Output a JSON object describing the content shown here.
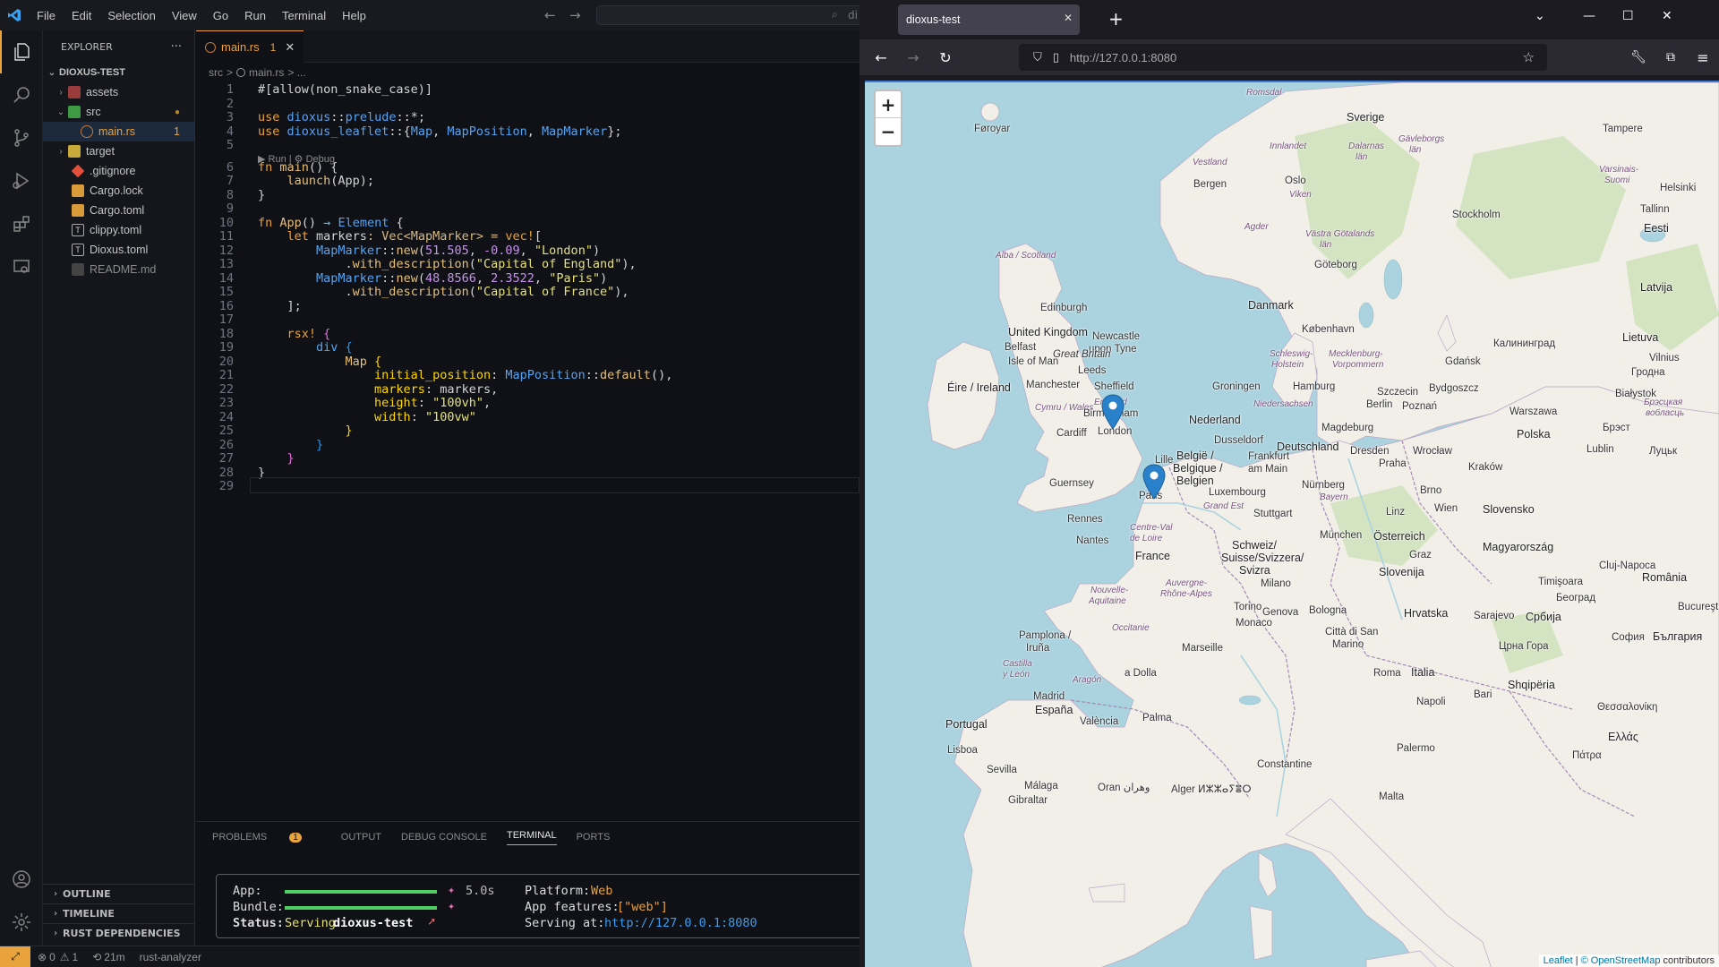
{
  "vscode": {
    "menu": [
      "File",
      "Edit",
      "Selection",
      "View",
      "Go",
      "Run",
      "Terminal",
      "Help"
    ],
    "search_hint": "di",
    "explorer": {
      "title": "EXPLORER",
      "more": "···",
      "project": "DIOXUS-TEST",
      "items": [
        {
          "label": "assets",
          "color": "#c4c4c4"
        },
        {
          "label": "src",
          "color": "#c4c4c4",
          "badge": "●"
        },
        {
          "label": "main.rs",
          "color": "#e8a33c",
          "badge": "1"
        },
        {
          "label": "target",
          "color": "#c4c4c4"
        },
        {
          "label": ".gitignore",
          "color": "#c4c4c4"
        },
        {
          "label": "Cargo.lock",
          "color": "#c4c4c4"
        },
        {
          "label": "Cargo.toml",
          "color": "#c4c4c4"
        },
        {
          "label": "clippy.toml",
          "color": "#c4c4c4"
        },
        {
          "label": "Dioxus.toml",
          "color": "#c4c4c4"
        },
        {
          "label": "README.md",
          "color": "#8a8a8a"
        }
      ],
      "sections": [
        "OUTLINE",
        "TIMELINE",
        "RUST DEPENDENCIES"
      ]
    },
    "tab": {
      "label": "main.rs",
      "badge": "1"
    },
    "breadcrumb": {
      "folder": "src",
      "sep": ">",
      "file": "main.rs",
      "rest": "> ..."
    },
    "codelens": "▶ Run | ⚙ Debug",
    "line_numbers": [
      "1",
      "2",
      "3",
      "4",
      "5",
      "6",
      "7",
      "8",
      "9",
      "10",
      "11",
      "12",
      "13",
      "14",
      "15",
      "16",
      "17",
      "18",
      "19",
      "20",
      "21",
      "22",
      "23",
      "24",
      "25",
      "26",
      "27",
      "28",
      "29"
    ],
    "code": {
      "l1": "#[allow(non_snake_case)]",
      "l3a": "use ",
      "l3b": "dioxus",
      "l3c": "::",
      "l3d": "prelude",
      "l3e": "::*;",
      "l4a": "use ",
      "l4b": "dioxus_leaflet",
      "l4c": "::{",
      "l4d": "Map",
      "l4e": ", ",
      "l4f": "MapPosition",
      "l4g": ", ",
      "l4h": "MapMarker",
      "l4i": "};",
      "l6a": "fn ",
      "l6b": "main",
      "l6c": "() {",
      "l7a": "    ",
      "l7b": "launch",
      "l7c": "(App);",
      "l8": "}",
      "l10a": "fn ",
      "l10b": "App",
      "l10c": "() ",
      "l10d": "→",
      "l10e": " Element ",
      "l10f": "{",
      "l11a": "    let ",
      "l11b": "markers",
      "l11c": ": Vec<MapMarker> = ",
      "l11d": "vec!",
      "l11e": "[",
      "l12a": "        MapMarker",
      "l12b": "::",
      "l12c": "new",
      "l12d": "(",
      "l12e": "51.505",
      "l12f": ", ",
      "l12g": "-0.09",
      "l12h": ", ",
      "l12i": "\"London\"",
      "l12j": ")",
      "l13a": "            .",
      "l13b": "with_description",
      "l13c": "(",
      "l13d": "\"Capital of England\"",
      "l13e": "),",
      "l14a": "        MapMarker",
      "l14b": "::",
      "l14c": "new",
      "l14d": "(",
      "l14e": "48.8566",
      "l14f": ", ",
      "l14g": "2.3522",
      "l14h": ", ",
      "l14i": "\"Paris\"",
      "l14j": ")",
      "l15a": "            .",
      "l15b": "with_description",
      "l15c": "(",
      "l15d": "\"Capital of France\"",
      "l15e": "),",
      "l16": "    ];",
      "l18a": "    rsx! ",
      "l18b": "{",
      "l19a": "        div ",
      "l19b": "{",
      "l20a": "            Map ",
      "l20b": "{",
      "l21a": "                initial_position",
      "l21b": ": ",
      "l21c": "MapPosition",
      "l21d": "::",
      "l21e": "default",
      "l21f": "(),",
      "l22a": "                markers",
      "l22b": ": markers,",
      "l23a": "                height",
      "l23b": ": ",
      "l23c": "\"100vh\"",
      "l23d": ",",
      "l24a": "                width",
      "l24b": ": ",
      "l24c": "\"100vw\"",
      "l25": "            }",
      "l26": "        }",
      "l27": "    }",
      "l28": "}"
    },
    "panel": {
      "tabs": [
        "PROBLEMS",
        "OUTPUT",
        "DEBUG CONSOLE",
        "TERMINAL",
        "PORTS"
      ],
      "problems_count": "1",
      "active": "TERMINAL",
      "terminal": {
        "app_label": "App:",
        "bundle_label": "Bundle:",
        "status_label": "Status:",
        "app_progress": 1.0,
        "bundle_progress": 1.0,
        "time": "5.0s",
        "status_word": "Serving",
        "status_name": "dioxus-test",
        "platform_label": "Platform:",
        "platform_value": "Web",
        "features_label": "App features:",
        "features_value": "[\"web\"]",
        "serving_label": "Serving at:",
        "serving_value": "http://127.0.0.1:8080"
      }
    },
    "statusbar": {
      "errors": "0",
      "warnings": "1",
      "time": "21m",
      "lsp": "rust-analyzer"
    }
  },
  "firefox": {
    "tab_title": "dioxus-test",
    "url": "http://127.0.0.1:8080",
    "map": {
      "zoom_in": "+",
      "zoom_out": "−",
      "attribution_leaflet": "Leaflet",
      "attribution_sep": "|",
      "attribution_osm": "© OpenStreetMap",
      "attribution_rest": "contributors",
      "markers": [
        {
          "name": "London",
          "lat": 51.505,
          "lng": -0.09
        },
        {
          "name": "Paris",
          "lat": 48.8566,
          "lng": 2.3522
        }
      ],
      "labels": {
        "foroyar": "Føroyar",
        "bergen": "Bergen",
        "oslo": "Oslo",
        "sverige": "Sverige",
        "stockholm": "Stockholm",
        "helsinki": "Helsinki",
        "tallinn": "Tallinn",
        "eesti": "Eesti",
        "latvija": "Latvija",
        "tampere": "Tampere",
        "goteborg": "Göteborg",
        "danmark": "Danmark",
        "kobenhavn": "København",
        "alba": "Alba / Scotland",
        "edinburgh": "Edinburgh",
        "uk": "United Kingdom",
        "newcastle": "Newcastle",
        "newcastle2": "upon Tyne",
        "belfast": "Belfast",
        "isleofman": "Isle of Man",
        "greatbritain": "Great Britain",
        "leeds": "Leeds",
        "manchester": "Manchester",
        "sheffield": "Sheffield",
        "eire": "Éire / Ireland",
        "england": "England",
        "cymru": "Cymru / Wales",
        "birmingham": "Birmingham",
        "cardiff": "Cardiff",
        "london": "London",
        "groningen": "Groningen",
        "hamburg": "Hamburg",
        "szczecin": "Szczecin",
        "gdansk": "Gdańsk",
        "kaliningrad": "Калининград",
        "lietuva": "Lietuva",
        "vilnius": "Vilnius",
        "hrodna": "Гродна",
        "bydgoszcz": "Bydgoszcz",
        "bialystok": "Białystok",
        "berlin": "Berlin",
        "poznan": "Poznań",
        "warszawa": "Warszawa",
        "brest": "Брэст",
        "nederland": "Nederland",
        "polska": "Polska",
        "magdeburg": "Magdeburg",
        "dusseldorf": "Dusseldorf",
        "deutschland": "Deutschland",
        "lublin": "Lublin",
        "lutsk": "Луцьк",
        "belgie": "België /",
        "belgique": "Belgique /",
        "belgien": "Belgien",
        "lille": "Lille",
        "frankfurt": "Frankfurt",
        "frankfurt2": "am Main",
        "dresden": "Dresden",
        "wroclaw": "Wrocław",
        "praha": "Praha",
        "krakow": "Kraków",
        "guernsey": "Guernsey",
        "luxembourg": "Luxembourg",
        "paris": "Paris",
        "nurnberg": "Nürnberg",
        "brno": "Brno",
        "rennes": "Rennes",
        "grandest": "Grand Est",
        "stuttgart": "Stuttgart",
        "wien": "Wien",
        "slovensko": "Slovensko",
        "munchen": "München",
        "linz": "Linz",
        "osterreich": "Österreich",
        "nantes": "Nantes",
        "centre": "Centre-Val",
        "centre2": "de Loire",
        "france": "France",
        "schweiz": "Schweiz/",
        "suisse": "Suisse/Svizzera/",
        "svizra": "Svizra",
        "graz": "Graz",
        "magyarorszag": "Magyarország",
        "clujnapoca": "Cluj-Napoca",
        "milano": "Milano",
        "slovenija": "Slovenija",
        "romania": "România",
        "timisoara": "Timişoara",
        "torino": "Torino",
        "nouvelle": "Nouvelle-",
        "aquitaine": "Aquitaine",
        "auvergne": "Auvergne-",
        "rhone": "Rhône-Alpes",
        "beograd": "Београд",
        "bologna": "Bologna",
        "genova": "Genova",
        "hrvatska": "Hrvatska",
        "sarajevo": "Sarajevo",
        "srbija": "Србија",
        "bucuresti": "Bucureşti",
        "monaco": "Monaco",
        "cittadisan": "Città di San",
        "marino": "Marino",
        "pamplona": "Pamplona /",
        "irunea": "Iruña",
        "occitanie": "Occitanie",
        "marseille": "Marseille",
        "crnagora": "Црна Гора",
        "sofia": "София",
        "balgaria": "България",
        "adolla": "a Dolla",
        "roma": "Roma",
        "italia": "Italia",
        "shqiperia": "Shqipëria",
        "bari": "Bari",
        "aragon": "Aragón",
        "castilla": "Castilla",
        "castilla2": "y León",
        "madrid": "Madrid",
        "espana": "España",
        "napoli": "Napoli",
        "thessaloniki": "Θεσσαλονίκη",
        "portugal": "Portugal",
        "valencia": "València",
        "lisboa": "Lisboa",
        "palma": "Palma",
        "palermo": "Palermo",
        "ellas": "Ελλάς",
        "patra": "Πάτρα",
        "sevilla": "Sevilla",
        "malaga": "Málaga",
        "oranwahran": "Oran وهران",
        "alger": "Alger ⵍⵣⵣⴰⵢⴻⵔ",
        "constantine": "Constantine",
        "gibraltar": "Gibraltar",
        "malta": "Malta",
        "innlandet": "Innlandet",
        "vestland": "Vestland",
        "romsdal": "Romsdal",
        "viken": "Viken",
        "agder": "Agder",
        "dalarnas": "Dalarnas",
        "dalarnas2": "län",
        "gavleborgs": "Gävleborgs",
        "gavleborgs2": "län",
        "vastra": "Västra Götalands",
        "vastra2": "län",
        "varsinais": "Varsinais-",
        "suomi": "Suomi",
        "schleswig": "Schleswig-",
        "holstein": "Holstein",
        "mecklenburg": "Mecklenburg-",
        "vorpommern": "Vorpommern",
        "niedersachsen": "Niedersachsen",
        "bayern": "Bayern",
        "brestskaya": "Брэсцкая",
        "voblasts": "вобласць"
      }
    }
  },
  "colors": {
    "accent": "#e8a33c",
    "progress": "#4fce64",
    "link": "#3b9cf0",
    "map_water": "#aad3df",
    "map_land": "#f2efe9",
    "marker": "#2a81cb"
  }
}
